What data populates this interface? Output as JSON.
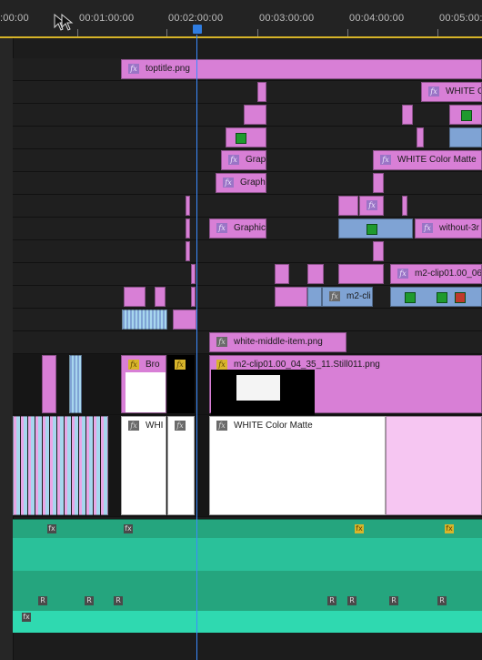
{
  "ruler": {
    "timecodes": [
      ":00:00",
      "00:01:00:00",
      "00:02:00:00",
      "00:03:00:00",
      "00:04:00:00",
      "00:05:00:"
    ]
  },
  "clips": {
    "toptitle": "toptitle.png",
    "white_c": "WHITE C",
    "grap": "Grap",
    "graph": "Graph",
    "white_color_matte_v5": "WHITE Color Matte",
    "graphic": "Graphic",
    "without": "without-3r",
    "m2_clip_06": "m2-clip01.00_06",
    "m2_cli": "m2-cli",
    "white_middle": "white-middle-item.png",
    "bro": "Bro",
    "m2_still": "m2-clip01.00_04_35_11.Still011.png",
    "whi": "WHI",
    "white_color_matte_v1": "WHITE Color Matte"
  },
  "icons": {
    "fx": "fx",
    "audio_r": "R"
  },
  "colors": {
    "playhead": "#3b8bff",
    "clip_pink": "#d87fd6",
    "clip_blue": "#7fa3d4",
    "audio_green": "#25a57e",
    "audio_cyan": "#2fd9b0",
    "ruler_work_area": "#d6b328"
  }
}
